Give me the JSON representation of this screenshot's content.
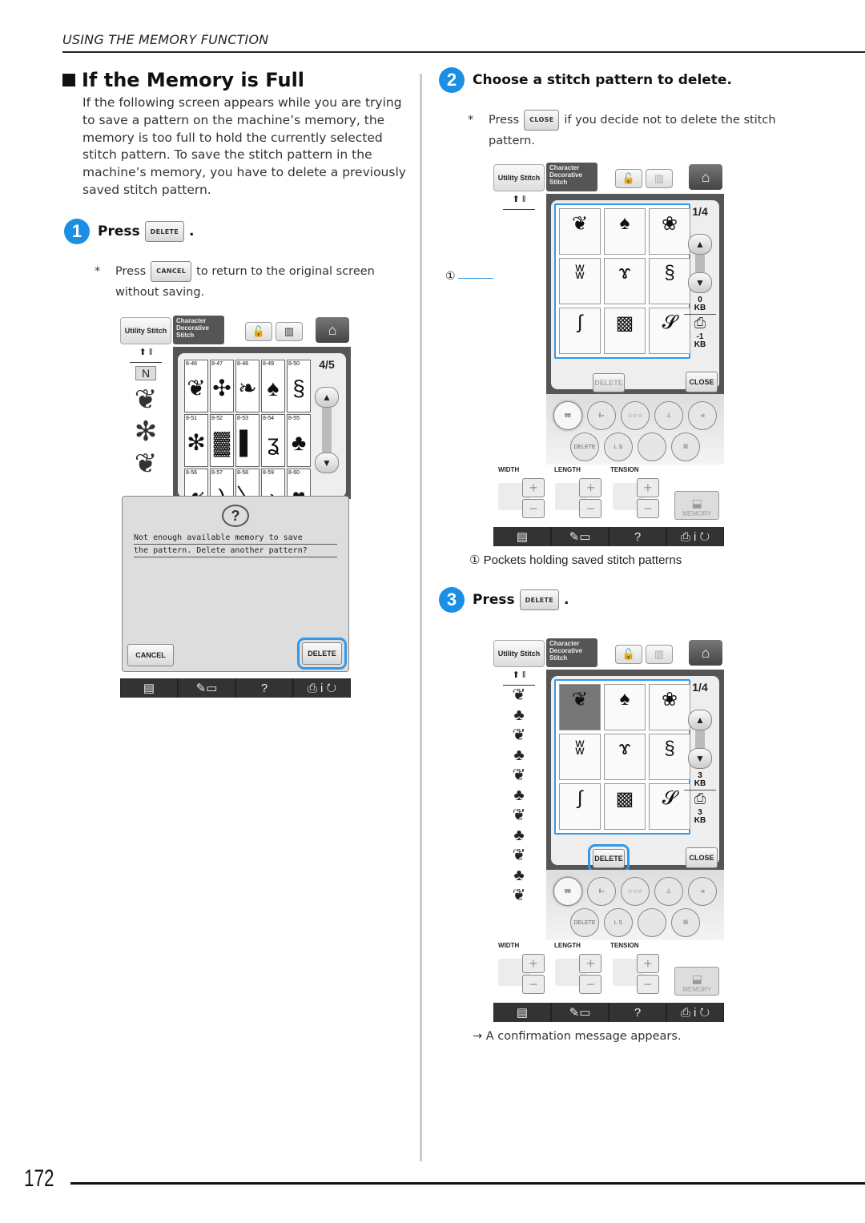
{
  "page": {
    "section_header": "USING THE MEMORY FUNCTION",
    "page_number": "172",
    "title": "If the Memory is Full",
    "intro": "If the following screen appears while you are trying to save a pattern on the machine’s memory, the memory is too full to hold the currently selected stitch pattern. To save the stitch pattern in the machine’s memory, you have to delete a previously saved stitch pattern."
  },
  "steps": [
    {
      "number": "1",
      "prefix": "Press",
      "button": "DELETE",
      "suffix": ".",
      "note": {
        "marker": "*",
        "prefix": "Press",
        "button": "CANCEL",
        "text": "to return to the original screen without saving."
      }
    },
    {
      "number": "2",
      "text": "Choose a stitch pattern to delete.",
      "note": {
        "marker": "*",
        "prefix": "Press",
        "button": "CLOSE",
        "text": "if you decide not to delete the stitch pattern."
      },
      "callout_number": "①",
      "callout_text": "Pockets holding saved stitch patterns"
    },
    {
      "number": "3",
      "prefix": "Press",
      "button": "DELETE",
      "suffix": ".",
      "result_arrow": "→",
      "result": "A confirmation message appears."
    }
  ],
  "screen_common": {
    "tab_utility": "Utility Stitch",
    "tab_character": "Character Decorative Stitch",
    "lock_icon": "🔓",
    "book_icon": "▥",
    "home_icon": "⌂",
    "needle_icon": "⬆ ǁ",
    "scroll_up": "▲",
    "scroll_down": "▼",
    "bottom_bar": [
      "▤",
      "✎▭",
      "?",
      "⎙ i ↻"
    ],
    "circle_buttons_row1": [
      "➿",
      "ǁ⌁",
      "☆☆☆",
      "⏃",
      "⊲"
    ],
    "circle_buttons_row2": [
      "DELETE",
      "L S",
      "",
      "ǁǁ"
    ],
    "adj_labels": [
      "WIDTH",
      "LENGTH",
      "TENSION"
    ],
    "plus": "+",
    "minus": "−",
    "memory_label": "MEMORY",
    "delete_label": "DELETE",
    "close_label": "CLOSE"
  },
  "screen1": {
    "page_indicator_top": "4",
    "page_indicator_bottom": "5",
    "stitches": [
      {
        "code": "8-46",
        "glyph": "❦"
      },
      {
        "code": "8-47",
        "glyph": "✣"
      },
      {
        "code": "8-48",
        "glyph": "❧"
      },
      {
        "code": "8-49",
        "glyph": "♠"
      },
      {
        "code": "8-50",
        "glyph": "§"
      },
      {
        "code": "8-51",
        "glyph": "✻"
      },
      {
        "code": "8-52",
        "glyph": "▓"
      },
      {
        "code": "8-53",
        "glyph": "▌"
      },
      {
        "code": "8-54",
        "glyph": "ʓ"
      },
      {
        "code": "8-55",
        "glyph": "♣"
      },
      {
        "code": "8-56",
        "glyph": "☙"
      },
      {
        "code": "8-57",
        "glyph": ")"
      },
      {
        "code": "8-58",
        "glyph": "〉"
      },
      {
        "code": "8-59",
        "glyph": "›"
      },
      {
        "code": "8-60",
        "glyph": "♥"
      }
    ],
    "preview_glyphs": [
      "❦",
      "✻",
      "❦"
    ],
    "dialog_lines": [
      "Not enough available memory to save",
      "the pattern. Delete another pattern?"
    ],
    "dialog_cancel": "CANCEL",
    "dialog_delete": "DELETE"
  },
  "screen2": {
    "page_indicator_top": "1",
    "page_indicator_bottom": "4",
    "pockets": [
      "❦",
      "♠",
      "❀",
      "ʬ",
      "ɤ",
      "§",
      "∫",
      "▩",
      "𝓢"
    ],
    "kb_top": "0",
    "kb_bottom": "-1",
    "kb_unit": "KB",
    "machine_icon": "⎙"
  },
  "screen3": {
    "page_indicator_top": "1",
    "page_indicator_bottom": "4",
    "pockets": [
      "❦",
      "♠",
      "❀",
      "ʬ",
      "ɤ",
      "§",
      "∫",
      "▩",
      "𝓢"
    ],
    "selected_pocket_index": 0,
    "kb_top": "3",
    "kb_bottom": "3",
    "kb_unit": "KB",
    "machine_icon": "⎙",
    "preview_glyphs": [
      "❦",
      "♣",
      "❦",
      "♣",
      "❦",
      "♣",
      "❦",
      "♣",
      "❦",
      "♣",
      "❦"
    ]
  }
}
